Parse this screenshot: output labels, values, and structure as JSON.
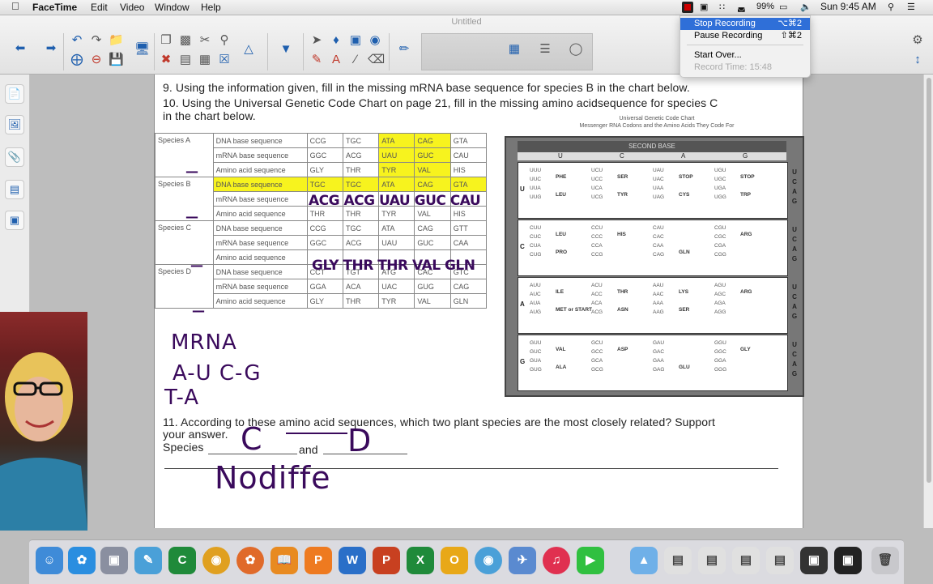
{
  "menubar": {
    "app": "FaceTime",
    "items": [
      "Edit",
      "Video",
      "Window",
      "Help"
    ],
    "battery": "99%",
    "clock": "Sun 9:45 AM"
  },
  "window": {
    "title": "Untitled"
  },
  "recording_menu": {
    "items": [
      {
        "label": "Stop Recording",
        "shortcut": "⌥⌘2"
      },
      {
        "label": "Pause Recording",
        "shortcut": "⇧⌘2"
      },
      {
        "label": "Start Over...",
        "shortcut": ""
      }
    ],
    "record_time": "Record Time: 15:48"
  },
  "worksheet": {
    "q9": "9. Using the information given, fill in the missing mRNA base sequence for species B in the chart below.",
    "q10_line1": "10. Using the Universal Genetic Code Chart on page 21, fill in the missing amino acidsequence for species C",
    "q10_line2": "in the chart below.",
    "species_table": [
      {
        "species": "Species A",
        "rows": [
          {
            "label": "DNA base sequence",
            "cells": [
              "CCG",
              "TGC",
              "ATA",
              "CAG",
              "GTA"
            ]
          },
          {
            "label": "mRNA base sequence",
            "cells": [
              "GGC",
              "ACG",
              "UAU",
              "GUC",
              "CAU"
            ]
          },
          {
            "label": "Amino acid sequence",
            "cells": [
              "GLY",
              "THR",
              "TYR",
              "VAL",
              "HIS"
            ]
          }
        ]
      },
      {
        "species": "Species B",
        "rows": [
          {
            "label": "DNA base sequence",
            "cells": [
              "TGC",
              "TGC",
              "ATA",
              "CAG",
              "GTA"
            ]
          },
          {
            "label": "mRNA base sequence",
            "cells": [
              "",
              "",
              "",
              "",
              ""
            ]
          },
          {
            "label": "Amino acid sequence",
            "cells": [
              "THR",
              "THR",
              "TYR",
              "VAL",
              "HIS"
            ]
          }
        ]
      },
      {
        "species": "Species C",
        "rows": [
          {
            "label": "DNA base sequence",
            "cells": [
              "CCG",
              "TGC",
              "ATA",
              "CAG",
              "GTT"
            ]
          },
          {
            "label": "mRNA base sequence",
            "cells": [
              "GGC",
              "ACG",
              "UAU",
              "GUC",
              "CAA"
            ]
          },
          {
            "label": "Amino acid sequence",
            "cells": [
              "",
              "",
              "",
              "",
              ""
            ]
          }
        ]
      },
      {
        "species": "Species D",
        "rows": [
          {
            "label": "DNA base sequence",
            "cells": [
              "CCT",
              "TGT",
              "ATG",
              "CAC",
              "GTC"
            ]
          },
          {
            "label": "mRNA base sequence",
            "cells": [
              "GGA",
              "ACA",
              "UAC",
              "GUG",
              "CAG"
            ]
          },
          {
            "label": "Amino acid sequence",
            "cells": [
              "GLY",
              "THR",
              "TYR",
              "VAL",
              "GLN"
            ]
          }
        ]
      }
    ],
    "code_chart_caption_1": "Universal Genetic Code Chart",
    "code_chart_caption_2": "Messenger RNA Codons and the Amino Acids They Code For",
    "code_chart": {
      "header": "SECOND BASE",
      "columns": [
        "U",
        "C",
        "A",
        "G"
      ],
      "rows": [
        {
          "first": "U",
          "third": [
            "U",
            "C",
            "A",
            "G"
          ],
          "cells": [
            [
              "UUU",
              "UUC",
              "UUA",
              "UUG"
            ],
            [
              "UCU",
              "UCC",
              "UCA",
              "UCG"
            ],
            [
              "UAU",
              "UAC",
              "UAA",
              "UAG"
            ],
            [
              "UGU",
              "UGC",
              "UGA",
              "UGG"
            ]
          ],
          "aa": [
            "PHE",
            "LEU",
            "SER",
            "TYR",
            "STOP",
            "CYS",
            "STOP",
            "TRP"
          ]
        },
        {
          "first": "C",
          "third": [
            "U",
            "C",
            "A",
            "G"
          ],
          "cells": [
            [
              "CUU",
              "CUC",
              "CUA",
              "CUG"
            ],
            [
              "CCU",
              "CCC",
              "CCA",
              "CCG"
            ],
            [
              "CAU",
              "CAC",
              "CAA",
              "CAG"
            ],
            [
              "CGU",
              "CGC",
              "CGA",
              "CGG"
            ]
          ],
          "aa": [
            "LEU",
            "PRO",
            "HIS",
            "GLN",
            "ARG"
          ]
        },
        {
          "first": "A",
          "third": [
            "U",
            "C",
            "A",
            "G"
          ],
          "cells": [
            [
              "AUU",
              "AUC",
              "AUA",
              "AUG"
            ],
            [
              "ACU",
              "ACC",
              "ACA",
              "ACG"
            ],
            [
              "AAU",
              "AAC",
              "AAA",
              "AAG"
            ],
            [
              "AGU",
              "AGC",
              "AGA",
              "AGG"
            ]
          ],
          "aa": [
            "ILE",
            "MET or START",
            "THR",
            "ASN",
            "LYS",
            "SER",
            "ARG"
          ]
        },
        {
          "first": "G",
          "third": [
            "U",
            "C",
            "A",
            "G"
          ],
          "cells": [
            [
              "GUU",
              "GUC",
              "GUA",
              "GUG"
            ],
            [
              "GCU",
              "GCC",
              "GCA",
              "GCG"
            ],
            [
              "GAU",
              "GAC",
              "GAA",
              "GAG"
            ],
            [
              "GGU",
              "GGC",
              "GGA",
              "GGG"
            ]
          ],
          "aa": [
            "VAL",
            "ALA",
            "ASP",
            "GLU",
            "GLY"
          ]
        }
      ]
    },
    "q11_line1": "11. According to these amino acid sequences, which two plant species are the most closely related? Support",
    "q11_line2": "your answer.",
    "q11_species": "Species",
    "q11_and": "and"
  },
  "handwriting": {
    "speciesB_mrna": "ACG ACG UAU GUC CAU",
    "speciesC_aa": "GLY THR THR VAL GLN",
    "notes_1": "MRNA",
    "notes_2": "A-U   C-G",
    "notes_3": "T-A",
    "answer_1": "C",
    "answer_2": "D",
    "answer_text": "Nodiffe"
  },
  "colors": {
    "highlight": "#f7f31e",
    "ink": "#3a0a5c",
    "menu_select": "#2f6fd8"
  }
}
